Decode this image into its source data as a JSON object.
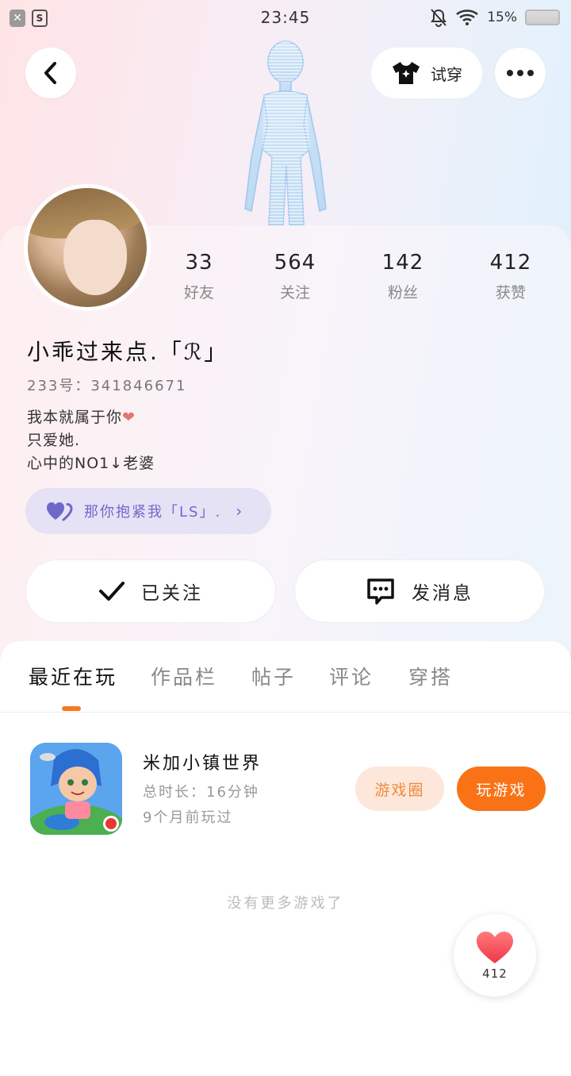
{
  "status_bar": {
    "time": "23:45",
    "battery_percent": "15%",
    "left_badges": [
      "x-icon",
      "s-icon"
    ]
  },
  "header": {
    "try_on_label": "试穿"
  },
  "profile": {
    "username": "小乖过来点.「ℛ」",
    "uid": "233号：341846671",
    "bio_lines": [
      "我本就属于你",
      "只爱她.",
      "心中的NO1↓老婆"
    ],
    "cp_label": "那你抱紧我「LS」."
  },
  "stats": [
    {
      "value": "33",
      "label": "好友"
    },
    {
      "value": "564",
      "label": "关注"
    },
    {
      "value": "142",
      "label": "粉丝"
    },
    {
      "value": "412",
      "label": "获赞"
    }
  ],
  "actions": {
    "follow_label": "已关注",
    "message_label": "发消息"
  },
  "tabs": [
    "最近在玩",
    "作品栏",
    "帖子",
    "评论",
    "穿搭"
  ],
  "active_tab": "最近在玩",
  "game": {
    "title": "米加小镇世界",
    "play_time": "总时长：16分钟",
    "last_played": "9个月前玩过",
    "circle_label": "游戏圈",
    "play_label": "玩游戏"
  },
  "footer_note": "没有更多游戏了",
  "like_fab": {
    "count": "412"
  },
  "colors": {
    "accent_orange": "#f97316",
    "chip_purple": "#6f68c9"
  }
}
